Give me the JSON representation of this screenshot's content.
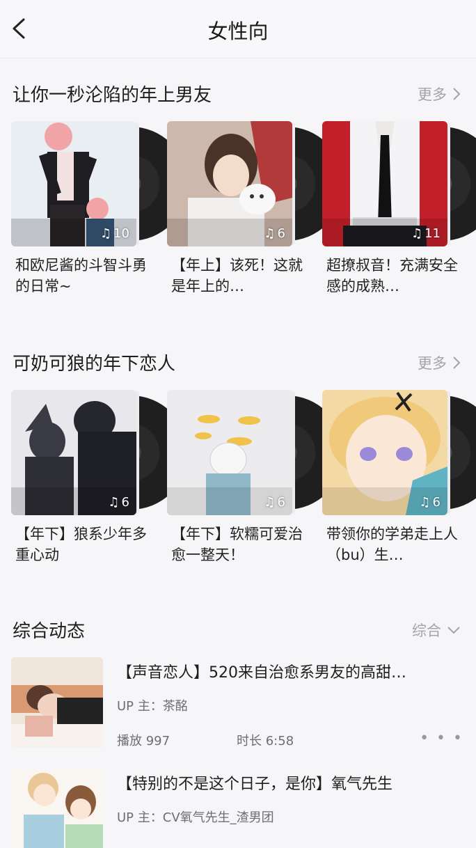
{
  "nav": {
    "title": "女性向"
  },
  "sections": [
    {
      "title": "让你一秒沦陷的年上男友",
      "more_label": "更多",
      "cards": [
        {
          "title": "和欧尼酱的斗智斗勇的日常~",
          "count": "10"
        },
        {
          "title": "【年上】该死！这就是年上的…",
          "count": "6"
        },
        {
          "title": "超撩叔音！充满安全感的成熟…",
          "count": "11"
        }
      ]
    },
    {
      "title": "可奶可狼的年下恋人",
      "more_label": "更多",
      "cards": [
        {
          "title": "【年下】狼系少年多重心动",
          "count": "6"
        },
        {
          "title": "【年下】软糯可爱治愈一整天！",
          "count": "6"
        },
        {
          "title": "带领你的学弟走上人（bu）生…",
          "count": "6"
        }
      ]
    }
  ],
  "feed": {
    "title": "综合动态",
    "filter_label": "综合",
    "items": [
      {
        "title": "【声音恋人】520来自治愈系男友的高甜…",
        "up_label": "UP 主：茶酩",
        "plays_label": "播放 997",
        "duration_label": "时长 6:58",
        "menu": "• • •"
      },
      {
        "title": "【特别的不是这个日子，是你】氧气先生",
        "up_label": "UP 主：CV氧气先生_渣男团"
      }
    ]
  },
  "icons": {
    "back": "back-chevron-icon",
    "more": "chevron-right-icon",
    "filter": "chevron-down-icon",
    "count": "music-note-icon"
  }
}
